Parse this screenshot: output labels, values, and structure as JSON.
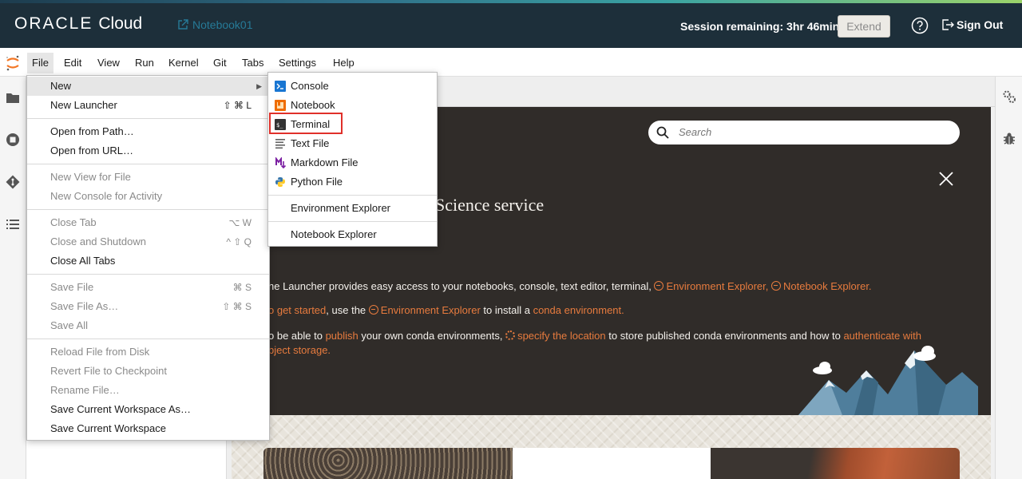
{
  "header": {
    "brand_oracle": "ORACLE",
    "brand_cloud": "Cloud",
    "notebook_name": "Notebook01",
    "session_text": "Session remaining: 3hr 46min",
    "extend_label": "Extend",
    "signout_label": "Sign Out",
    "colors": {
      "background": "#1d2f3a",
      "link": "#267a97"
    }
  },
  "menubar": {
    "items": [
      "File",
      "Edit",
      "View",
      "Run",
      "Kernel",
      "Git",
      "Tabs",
      "Settings",
      "Help"
    ],
    "active": "File"
  },
  "sidebar": {
    "icons": [
      "folder-icon",
      "stop-circle-icon",
      "git-icon",
      "list-icon"
    ]
  },
  "right_rail": {
    "icons": [
      "gears-icon",
      "bug-icon"
    ]
  },
  "file_menu": {
    "items": [
      {
        "label": "New",
        "submenu": true,
        "highlighted": true
      },
      {
        "label": "New Launcher",
        "shortcut": "⇧ ⌘ L"
      },
      {
        "label": "Open from Path…"
      },
      {
        "label": "Open from URL…"
      },
      {
        "label": "New View for File",
        "disabled": true
      },
      {
        "label": "New Console for Activity",
        "disabled": true
      },
      {
        "label": "Close Tab",
        "shortcut": "⌥ W",
        "disabled": true
      },
      {
        "label": "Close and Shutdown",
        "shortcut": "^ ⇧ Q",
        "disabled": true
      },
      {
        "label": "Close All Tabs"
      },
      {
        "label": "Save File",
        "shortcut": "⌘ S",
        "disabled": true
      },
      {
        "label": "Save File As…",
        "shortcut": "⇧ ⌘ S",
        "disabled": true
      },
      {
        "label": "Save All",
        "disabled": true
      },
      {
        "label": "Reload File from Disk",
        "disabled": true
      },
      {
        "label": "Revert File to Checkpoint",
        "disabled": true
      },
      {
        "label": "Rename File…",
        "disabled": true
      },
      {
        "label": "Save Current Workspace As…"
      },
      {
        "label": "Save Current Workspace"
      }
    ]
  },
  "new_submenu": {
    "items": [
      {
        "label": "Console",
        "icon": "console-icon"
      },
      {
        "label": "Notebook",
        "icon": "notebook-icon"
      },
      {
        "label": "Terminal",
        "icon": "terminal-icon",
        "highlighted": true
      },
      {
        "label": "Text File",
        "icon": "text-file-icon"
      },
      {
        "label": "Markdown File",
        "icon": "markdown-icon"
      },
      {
        "label": "Python File",
        "icon": "python-icon"
      },
      {
        "label": "Environment Explorer"
      },
      {
        "label": "Notebook Explorer"
      }
    ]
  },
  "launcher": {
    "search_placeholder": "Search",
    "title_fragment": "Science service",
    "line1_text": "he Launcher provides easy access to your notebooks, console, text editor, terminal,",
    "line1_link1": "Environment Explorer,",
    "line1_link2": "Notebook Explorer.",
    "line2_link_start": "o get started",
    "line2_text1": ", use the",
    "line2_link_env": "Environment Explorer",
    "line2_text2": "to install a",
    "line2_link_conda": "conda environment.",
    "line3_text1": "o be able to",
    "line3_link_publish": "publish",
    "line3_text2": "your own conda environments,",
    "line3_link_location": "specify the location",
    "line3_text3": "to store published conda environments and how to",
    "line3_link_auth": "authenticate with",
    "line4_link": "bject storage.",
    "colors": {
      "background": "#302c29",
      "accent": "#e77b3e",
      "text": "#f4f1ec"
    }
  }
}
